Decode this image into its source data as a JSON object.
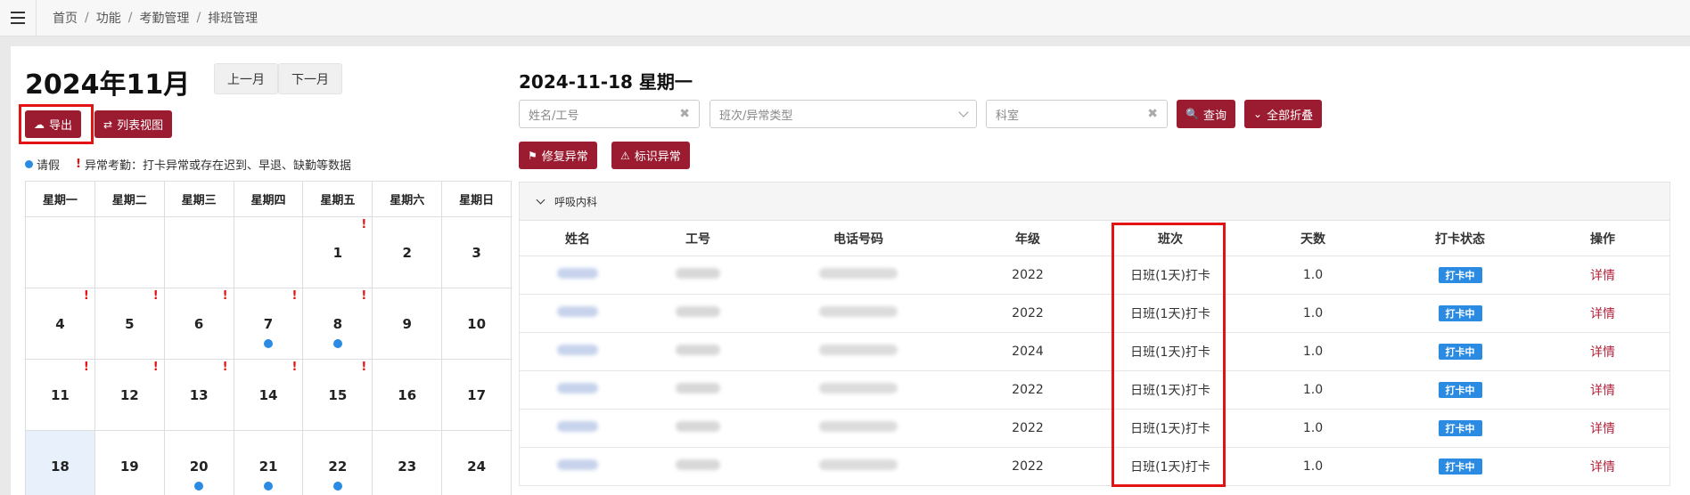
{
  "breadcrumb": [
    "首页",
    "功能",
    "考勤管理",
    "排班管理"
  ],
  "calendar_panel": {
    "month_title": "2024年11月",
    "prev_month": "上一月",
    "next_month": "下一月",
    "export_label": "导出",
    "list_view_label": "列表视图",
    "legend_leave": "请假",
    "legend_abnormal": "异常考勤：打卡异常或存在迟到、早退、缺勤等数据",
    "weekdays": [
      "星期一",
      "星期二",
      "星期三",
      "星期四",
      "星期五",
      "星期六",
      "星期日"
    ],
    "weeks": [
      [
        {
          "day": ""
        },
        {
          "day": ""
        },
        {
          "day": ""
        },
        {
          "day": ""
        },
        {
          "day": "1",
          "abnormal": true
        },
        {
          "day": "2"
        },
        {
          "day": "3"
        }
      ],
      [
        {
          "day": "4",
          "abnormal": true
        },
        {
          "day": "5",
          "abnormal": true
        },
        {
          "day": "6",
          "abnormal": true
        },
        {
          "day": "7",
          "abnormal": true,
          "leave": true
        },
        {
          "day": "8",
          "abnormal": true,
          "leave": true
        },
        {
          "day": "9"
        },
        {
          "day": "10"
        }
      ],
      [
        {
          "day": "11",
          "abnormal": true
        },
        {
          "day": "12",
          "abnormal": true
        },
        {
          "day": "13",
          "abnormal": true
        },
        {
          "day": "14",
          "abnormal": true
        },
        {
          "day": "15",
          "abnormal": true
        },
        {
          "day": "16"
        },
        {
          "day": "17"
        }
      ],
      [
        {
          "day": "18",
          "today": true
        },
        {
          "day": "19"
        },
        {
          "day": "20",
          "leave": true
        },
        {
          "day": "21",
          "leave": true
        },
        {
          "day": "22",
          "leave": true
        },
        {
          "day": "23"
        },
        {
          "day": "24"
        }
      ]
    ]
  },
  "detail_panel": {
    "date_title": "2024-11-18 星期一",
    "name_placeholder": "姓名/工号",
    "shift_placeholder": "班次/异常类型",
    "dept_placeholder": "科室",
    "query_label": "查询",
    "collapse_label": "全部折叠",
    "fix_abnormal_label": "修复异常",
    "mark_abnormal_label": "标识异常",
    "group_name": "呼吸内科",
    "columns": [
      "姓名",
      "工号",
      "电话号码",
      "年级",
      "班次",
      "天数",
      "打卡状态",
      "操作"
    ],
    "rows": [
      {
        "grade": "2022",
        "shift": "日班(1天)打卡",
        "days": "1.0",
        "status": "打卡中",
        "action": "详情"
      },
      {
        "grade": "2022",
        "shift": "日班(1天)打卡",
        "days": "1.0",
        "status": "打卡中",
        "action": "详情"
      },
      {
        "grade": "2024",
        "shift": "日班(1天)打卡",
        "days": "1.0",
        "status": "打卡中",
        "action": "详情"
      },
      {
        "grade": "2022",
        "shift": "日班(1天)打卡",
        "days": "1.0",
        "status": "打卡中",
        "action": "详情"
      },
      {
        "grade": "2022",
        "shift": "日班(1天)打卡",
        "days": "1.0",
        "status": "打卡中",
        "action": "详情"
      },
      {
        "grade": "2022",
        "shift": "日班(1天)打卡",
        "days": "1.0",
        "status": "打卡中",
        "action": "详情"
      }
    ]
  },
  "colors": {
    "accent": "#9b1c31",
    "leave_dot": "#2b8ae2",
    "highlight": "#e41313",
    "badge": "#2b8ae2"
  },
  "icons": [
    "menu-icon",
    "cloud-download-icon",
    "swap-icon",
    "search-icon",
    "chevron-down-icon",
    "flag-icon",
    "warning-icon",
    "close-icon"
  ]
}
